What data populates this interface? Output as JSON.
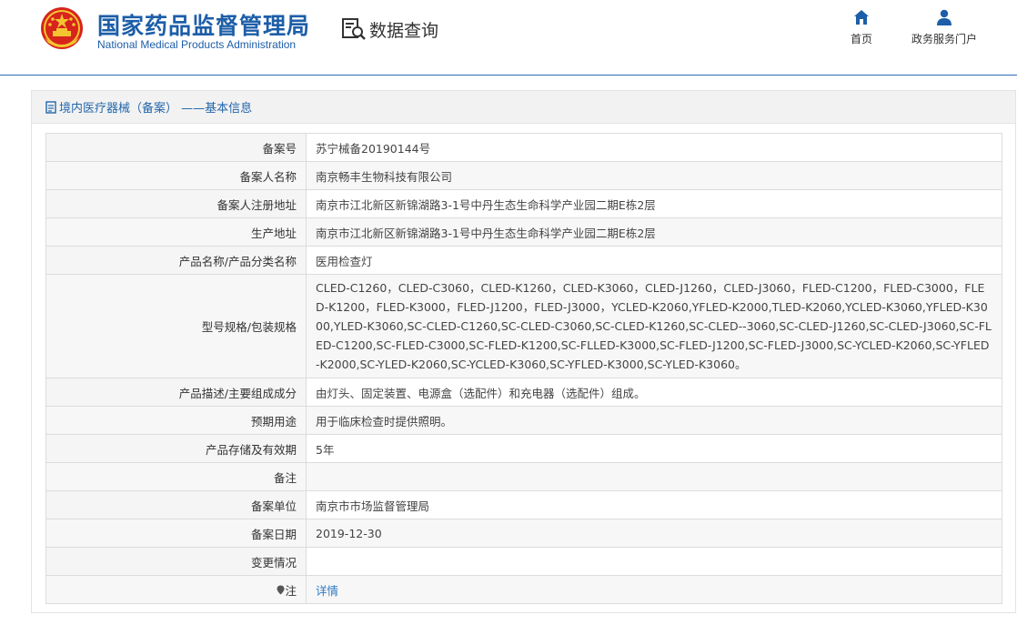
{
  "header": {
    "brand_cn": "国家药品监督管理局",
    "brand_en": "National Medical Products Administration",
    "query_label": "数据查询",
    "nav": [
      {
        "label": "首页",
        "icon": "home-icon"
      },
      {
        "label": "政务服务门户",
        "icon": "user-icon"
      }
    ]
  },
  "panel": {
    "title": "境内医疗器械（备案） ——基本信息",
    "rows": [
      {
        "key": "备案号",
        "value": "苏宁械备20190144号"
      },
      {
        "key": "备案人名称",
        "value": "南京畅丰生物科技有限公司"
      },
      {
        "key": "备案人注册地址",
        "value": "南京市江北新区新锦湖路3-1号中丹生态生命科学产业园二期E栋2层"
      },
      {
        "key": "生产地址",
        "value": "南京市江北新区新锦湖路3-1号中丹生态生命科学产业园二期E栋2层"
      },
      {
        "key": "产品名称/产品分类名称",
        "value": "医用检查灯"
      },
      {
        "key": "型号规格/包装规格",
        "value": "CLED-C1260，CLED-C3060，CLED-K1260，CLED-K3060，CLED-J1260，CLED-J3060，FLED-C1200，FLED-C3000，FLED-K1200，FLED-K3000，FLED-J1200，FLED-J3000，YCLED-K2060,YFLED-K2000,TLED-K2060,YCLED-K3060,YFLED-K3000,YLED-K3060,SC-CLED-C1260,SC-CLED-C3060,SC-CLED-K1260,SC-CLED--3060,SC-CLED-J1260,SC-CLED-J3060,SC-FLED-C1200,SC-FLED-C3000,SC-FLED-K1200,SC-FLLED-K3000,SC-FLED-J1200,SC-FLED-J3000,SC-YCLED-K2060,SC-YFLED-K2000,SC-YLED-K2060,SC-YCLED-K3060,SC-YFLED-K3000,SC-YLED-K3060。"
      },
      {
        "key": "产品描述/主要组成成分",
        "value": "由灯头、固定装置、电源盒（选配件）和充电器（选配件）组成。"
      },
      {
        "key": "预期用途",
        "value": "用于临床检查时提供照明。"
      },
      {
        "key": "产品存储及有效期",
        "value": "5年"
      },
      {
        "key": "备注",
        "value": ""
      },
      {
        "key": "备案单位",
        "value": "南京市市场监督管理局"
      },
      {
        "key": "备案日期",
        "value": "2019-12-30"
      },
      {
        "key": "变更情况",
        "value": ""
      },
      {
        "key": "注",
        "value": "详情",
        "icon": "pin-icon"
      }
    ]
  }
}
